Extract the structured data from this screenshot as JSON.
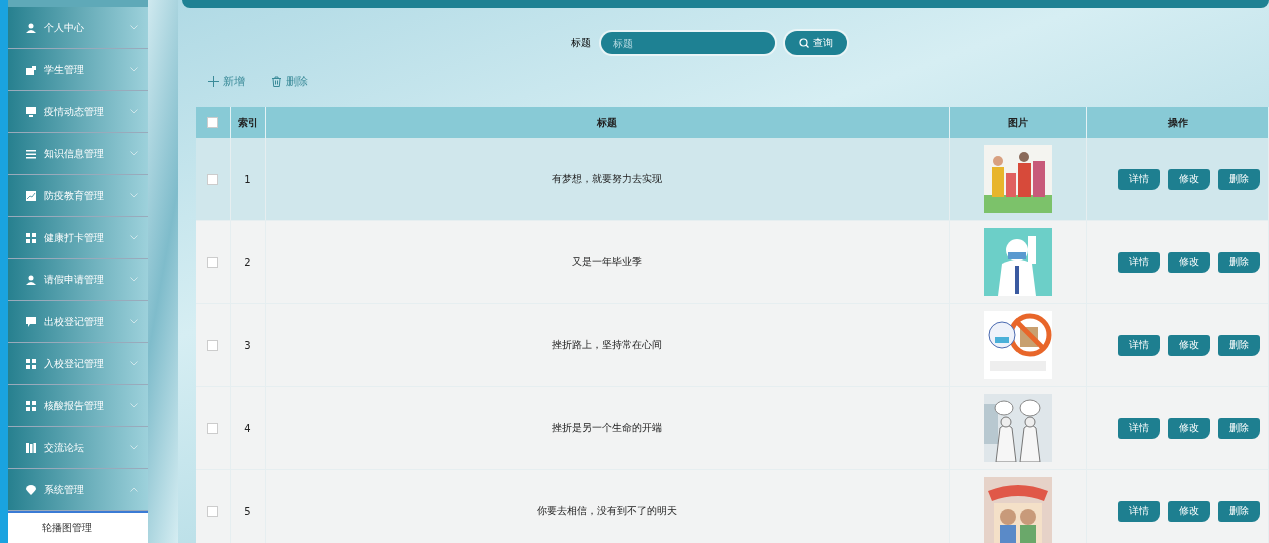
{
  "sidebar": {
    "items": [
      {
        "label": "个人中心",
        "expanded": false
      },
      {
        "label": "学生管理",
        "expanded": false
      },
      {
        "label": "疫情动态管理",
        "expanded": false
      },
      {
        "label": "知识信息管理",
        "expanded": false
      },
      {
        "label": "防疫教育管理",
        "expanded": false
      },
      {
        "label": "健康打卡管理",
        "expanded": false
      },
      {
        "label": "请假申请管理",
        "expanded": false
      },
      {
        "label": "出校登记管理",
        "expanded": false
      },
      {
        "label": "入校登记管理",
        "expanded": false
      },
      {
        "label": "核酸报告管理",
        "expanded": false
      },
      {
        "label": "交流论坛",
        "expanded": false
      },
      {
        "label": "系统管理",
        "expanded": true,
        "children": [
          {
            "label": "轮播图管理"
          }
        ]
      }
    ]
  },
  "search": {
    "label": "标题",
    "placeholder": "标题",
    "button": "查询"
  },
  "actions": [
    {
      "kind": "add",
      "label": "新增"
    },
    {
      "kind": "delete",
      "label": "删除"
    }
  ],
  "table": {
    "columns": [
      "索引",
      "标题",
      "图片",
      "操作"
    ],
    "select_all_checked": false,
    "rows": [
      {
        "checked": false,
        "highlighted": true,
        "index": "1",
        "title": "有梦想，就要努力去实现",
        "picture": {
          "kind": "picture"
        },
        "buttons": [
          "详情",
          "修改",
          "删除"
        ]
      },
      {
        "checked": false,
        "highlighted": false,
        "index": "2",
        "title": "又是一年毕业季",
        "picture": {
          "kind": "picture"
        },
        "buttons": [
          "详情",
          "修改",
          "删除"
        ]
      },
      {
        "checked": false,
        "highlighted": false,
        "index": "3",
        "title": "挫折路上，坚持常在心间",
        "picture": {
          "kind": "picture"
        },
        "buttons": [
          "详情",
          "修改",
          "删除"
        ]
      },
      {
        "checked": false,
        "highlighted": false,
        "index": "4",
        "title": "挫折是另一个生命的开端",
        "picture": {
          "kind": "picture"
        },
        "buttons": [
          "详情",
          "修改",
          "删除"
        ]
      },
      {
        "checked": false,
        "highlighted": false,
        "index": "5",
        "title": "你要去相信，没有到不了的明天",
        "picture": {
          "kind": "picture"
        },
        "buttons": [
          "详情",
          "修改",
          "删除"
        ]
      }
    ]
  }
}
